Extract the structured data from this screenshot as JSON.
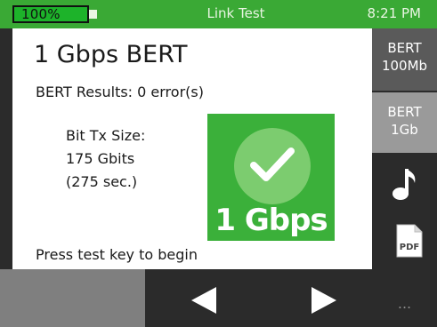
{
  "status_bar": {
    "battery_label": "100%",
    "battery_level": 1.0,
    "title": "Link Test",
    "time": "8:21 PM",
    "bar_color": "#3aa935",
    "battery_color": "#1db32a"
  },
  "main": {
    "title": "1 Gbps BERT",
    "results": "BERT Results: 0 error(s)",
    "tx_label": "Bit Tx Size:",
    "tx_size": "175 Gbits",
    "tx_duration": "(275 sec.)",
    "speed_tile": {
      "icon": "checkmark-icon",
      "label": "1 Gbps",
      "color": "#3bb03a"
    },
    "hint": "Press test key to begin"
  },
  "side_buttons": [
    {
      "line1": "BERT",
      "line2": "100Mb"
    },
    {
      "line1": "BERT",
      "line2": "1Gb"
    },
    {
      "icon": "music-note-icon"
    },
    {
      "icon": "pdf-icon",
      "icon_text": "PDF"
    }
  ],
  "bottom_bar": {
    "prev_icon": "left-arrow-icon",
    "next_icon": "right-arrow-icon",
    "more_label": "..."
  }
}
